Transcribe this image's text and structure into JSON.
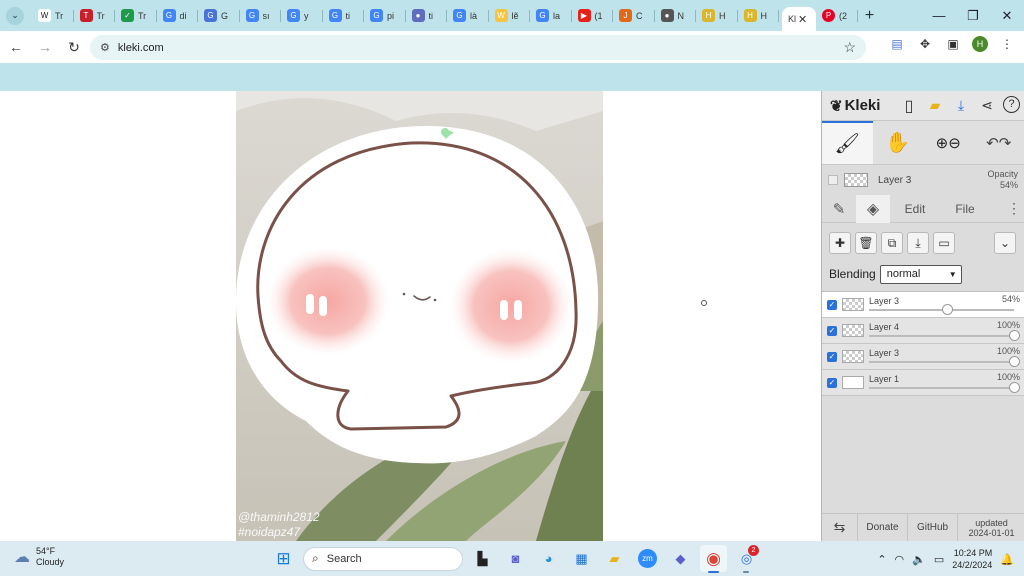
{
  "browser": {
    "tabs": [
      {
        "title": "Tr",
        "color": "#ffffff",
        "glyph": "W"
      },
      {
        "title": "Tr",
        "color": "#c8202a",
        "glyph": "T"
      },
      {
        "title": "Tr",
        "color": "#1f9a4a",
        "glyph": "✓"
      },
      {
        "title": "di",
        "color": "#4285f4",
        "glyph": "G"
      },
      {
        "title": "G",
        "color": "#4a73d8",
        "glyph": "G"
      },
      {
        "title": "sı",
        "color": "#4285f4",
        "glyph": "G"
      },
      {
        "title": "y",
        "color": "#4285f4",
        "glyph": "G"
      },
      {
        "title": "ti",
        "color": "#4285f4",
        "glyph": "G"
      },
      {
        "title": "pi",
        "color": "#4285f4",
        "glyph": "G"
      },
      {
        "title": "ti",
        "color": "#5f6dbf",
        "glyph": "●"
      },
      {
        "title": "là",
        "color": "#4285f4",
        "glyph": "G"
      },
      {
        "title": "lẽ",
        "color": "#f5c542",
        "glyph": "W"
      },
      {
        "title": "la",
        "color": "#4285f4",
        "glyph": "G"
      },
      {
        "title": "(1",
        "color": "#e62117",
        "glyph": "▶"
      },
      {
        "title": "C",
        "color": "#e06a1a",
        "glyph": "J"
      },
      {
        "title": "N",
        "color": "#555555",
        "glyph": "●"
      },
      {
        "title": "H",
        "color": "#d9b62b",
        "glyph": "H"
      },
      {
        "title": "H",
        "color": "#d9b62b",
        "glyph": "H"
      }
    ],
    "active_tab": {
      "title": "Kl",
      "close": "✕"
    },
    "extra_tab": {
      "title": "(2",
      "color": "#e60023",
      "glyph": "P"
    },
    "new_tab": "+",
    "window_controls": {
      "minimize": "—",
      "restore": "❐",
      "close": "✕"
    },
    "url": "kleki.com"
  },
  "kleki": {
    "logo": "Kleki",
    "current_layer": {
      "name": "Layer 3",
      "opacity_label": "Opacity",
      "opacity": "54%"
    },
    "tabs": {
      "edit": "Edit",
      "file": "File"
    },
    "blending_label": "Blending",
    "blending_value": "normal",
    "layers": [
      {
        "name": "Layer 3",
        "opacity": "54%",
        "value": 0.54,
        "selected": true,
        "thumb": "art"
      },
      {
        "name": "Layer 4",
        "opacity": "100%",
        "value": 1.0,
        "selected": false,
        "thumb": "checker"
      },
      {
        "name": "Layer 3",
        "opacity": "100%",
        "value": 1.0,
        "selected": false,
        "thumb": "checker"
      },
      {
        "name": "Layer 1",
        "opacity": "100%",
        "value": 1.0,
        "selected": false,
        "thumb": "white"
      }
    ],
    "bottom": {
      "donate": "Donate",
      "github": "GitHub",
      "updated_label": "updated",
      "updated_date": "2024-01-01"
    }
  },
  "artwork": {
    "watermark_line1": "@thaminh2812",
    "watermark_line2": "#noidapz47"
  },
  "taskbar": {
    "weather_temp": "54°F",
    "weather_desc": "Cloudy",
    "search_placeholder": "Search",
    "notification_count": "2",
    "time": "10:24 PM",
    "date": "24/2/2024"
  }
}
